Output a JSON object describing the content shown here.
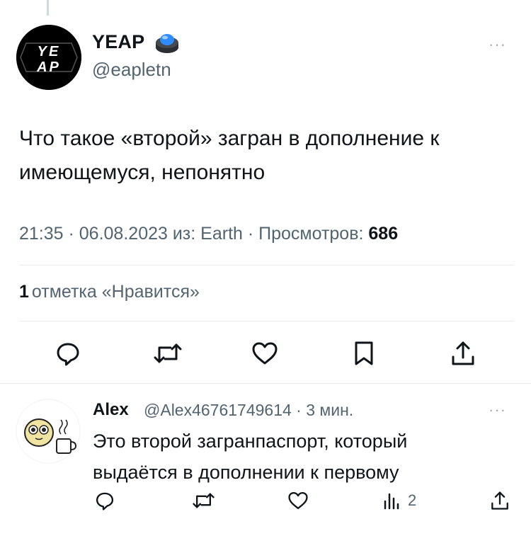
{
  "tweet": {
    "author_name": "YEAP",
    "author_handle": "@eapletn",
    "avatar_text_top": "YE",
    "avatar_text_bottom": "AP",
    "more_label": "···",
    "text_line1": "Что такое «второй» загран в дополнение к",
    "text_line2": "имеющемуся, непонятно",
    "meta_prefix": "21:35 · 06.08.2023 из: Earth · Просмотров: ",
    "views": "686",
    "likes_count": "1",
    "likes_label": "отметка «Нравится»"
  },
  "actions_main": [
    "reply-icon",
    "retweet-icon",
    "like-icon",
    "bookmark-icon",
    "share-icon"
  ],
  "reply": {
    "author_name": "Alex",
    "meta": "@Alex46761749614 · 3 мин.",
    "more_label": "···",
    "text_line1": "Это второй загранпаспорт, который",
    "text_line2": "выдаётся в дополнении к первому",
    "analytics_count": "2"
  },
  "colors": {
    "text": "#0f1419",
    "secondary": "#536471",
    "divider": "#e6ecf0",
    "badge_blue": "#2f8cff"
  }
}
